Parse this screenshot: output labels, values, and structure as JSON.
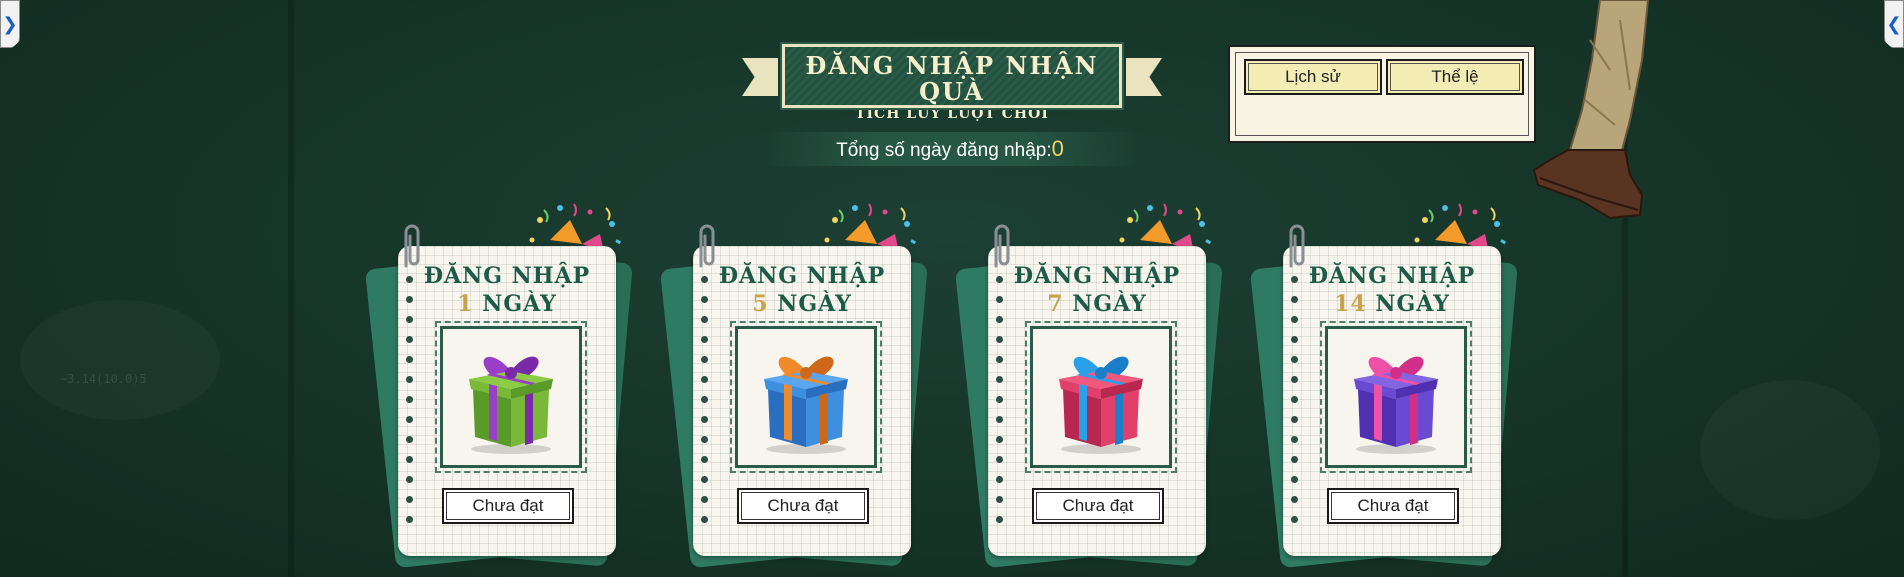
{
  "banner": {
    "title": "ĐĂNG NHẬP NHẬN QUÀ",
    "subtitle": "TÍCH LŨY LƯỢT CHƠI"
  },
  "login_total": {
    "label": "Tổng số ngày đăng nhập:",
    "value": "0"
  },
  "panel": {
    "history_label": "Lịch sử",
    "rules_label": "Thể lệ"
  },
  "cards": [
    {
      "title": "ĐĂNG NHẬP",
      "days": "1",
      "days_label": "NGÀY",
      "status": "Chưa đạt",
      "gift_color": "green-purple"
    },
    {
      "title": "ĐĂNG NHẬP",
      "days": "5",
      "days_label": "NGÀY",
      "status": "Chưa đạt",
      "gift_color": "blue-orange"
    },
    {
      "title": "ĐĂNG NHẬP",
      "days": "7",
      "days_label": "NGÀY",
      "status": "Chưa đạt",
      "gift_color": "pink-blue"
    },
    {
      "title": "ĐĂNG NHẬP",
      "days": "14",
      "days_label": "NGÀY",
      "status": "Chưa đạt",
      "gift_color": "purple-pink"
    }
  ],
  "nav": {
    "left_arrow": "❯",
    "right_arrow": "❮"
  },
  "chalk_note": "−3.14(10.0)5"
}
